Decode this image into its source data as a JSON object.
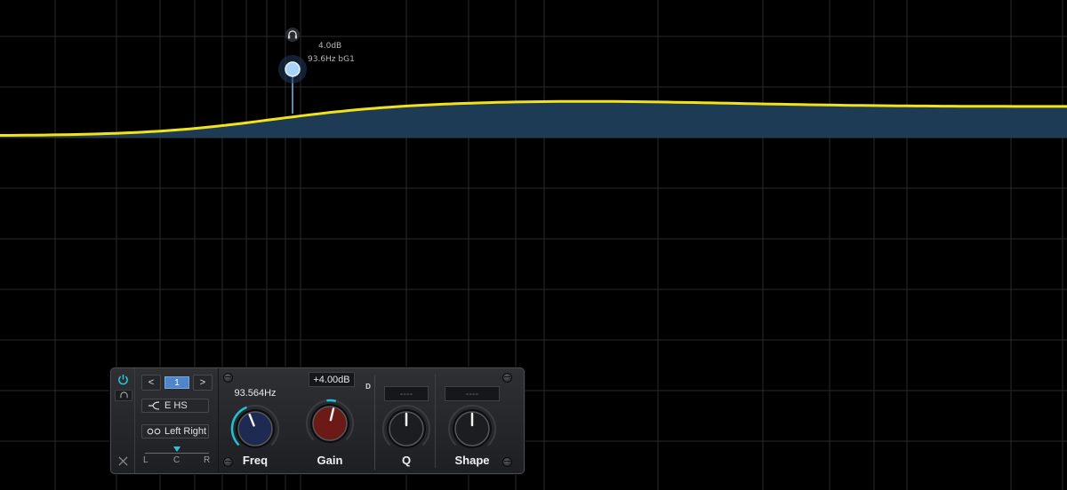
{
  "graph": {
    "node": {
      "gain_label": "4.0dB",
      "freq_label": "93.6Hz bG1",
      "listen_icon": "headphones-icon"
    },
    "colors": {
      "curve": "#f2e21a",
      "fill": "#1d3b55",
      "node": "#a9d3f5",
      "node_stem": "#7fb7e6",
      "grid": "#2a2a2a"
    }
  },
  "panel": {
    "power_icon": "power-icon",
    "listen_icon": "headphones-icon",
    "close_icon": "close-icon",
    "band_prev": "<",
    "band_next": ">",
    "band_number": "1",
    "filter_type_icon": "high-shelf-icon",
    "filter_type": "E HS",
    "stereo_icon": "stereo-icon",
    "stereo_mode": "Left Right",
    "pan": {
      "left": "L",
      "center": "C",
      "right": "R",
      "position": 0.5
    },
    "dynamic_badge": "D",
    "knobs": {
      "freq": {
        "label": "Freq",
        "value": "93.564Hz",
        "position": 0.42,
        "color": "#1f2a52"
      },
      "gain": {
        "label": "Gain",
        "value": "+4.00dB",
        "position": 0.55,
        "color": "#6b1a16"
      },
      "q": {
        "label": "Q",
        "value": "----",
        "position": 0.5,
        "color": "#1c1d20"
      },
      "shape": {
        "label": "Shape",
        "value": "----",
        "position": 0.5,
        "color": "#1c1d20"
      }
    },
    "accent": "#22c1d6"
  }
}
